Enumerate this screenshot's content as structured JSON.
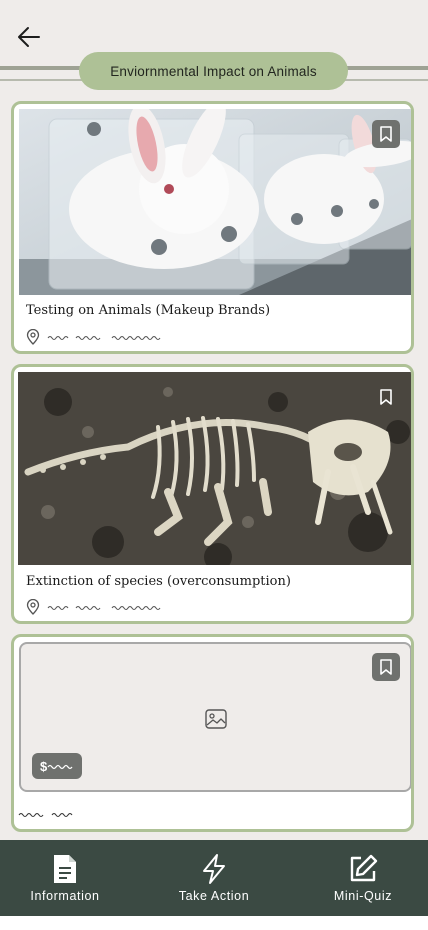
{
  "header": {
    "title": "Enviornmental Impact on Animals"
  },
  "cards": [
    {
      "title": "Testing on Animals (Makeup Brands)",
      "image": "rabbits-in-restrainers"
    },
    {
      "title": "Extinction of species (overconsumption)",
      "image": "dinosaur-skeleton-fossil"
    },
    {
      "title": "",
      "image": "image-placeholder"
    }
  ],
  "bottom_nav": {
    "items": [
      {
        "label": "Information",
        "icon": "document-icon"
      },
      {
        "label": "Take Action",
        "icon": "lightning-icon"
      },
      {
        "label": "Mini-Quiz",
        "icon": "edit-icon"
      }
    ]
  },
  "colors": {
    "accent": "#aec196",
    "nav_bg": "#3b4a43",
    "page_bg": "#efecea"
  }
}
